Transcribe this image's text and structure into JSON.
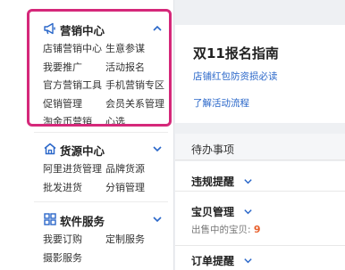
{
  "sidebar": {
    "marketing": {
      "title": "营销中心",
      "icon": "megaphone-icon",
      "links": [
        [
          "店铺营销中心",
          "生意参谋"
        ],
        [
          "我要推广",
          "活动报名"
        ],
        [
          "官方营销工具",
          "手机营销专区"
        ],
        [
          "促销管理",
          "会员关系管理"
        ],
        [
          "淘金币营销",
          "心选"
        ]
      ]
    },
    "sourcing": {
      "title": "货源中心",
      "icon": "house-icon",
      "links": [
        [
          "阿里进货管理",
          "品牌货源"
        ],
        [
          "批发进货",
          "分销管理"
        ]
      ]
    },
    "software": {
      "title": "软件服务",
      "icon": "grid-icon",
      "links": [
        [
          "我要订购",
          "定制服务"
        ],
        [
          "摄影服务",
          ""
        ]
      ]
    }
  },
  "guide": {
    "title": "双11报名指南",
    "link1": "店铺红包防资损必读",
    "link2": "了解活动流程"
  },
  "todo": {
    "header": "待办事项",
    "violation": "违规提醒",
    "item_manage": "宝贝管理",
    "on_sale_label": "出售中的宝贝:",
    "on_sale_count": "9",
    "order_reminder": "订单提醒"
  },
  "colors": {
    "accent_blue": "#2a67c9",
    "highlight_pink": "#d5287a",
    "count_orange": "#e8602c"
  }
}
